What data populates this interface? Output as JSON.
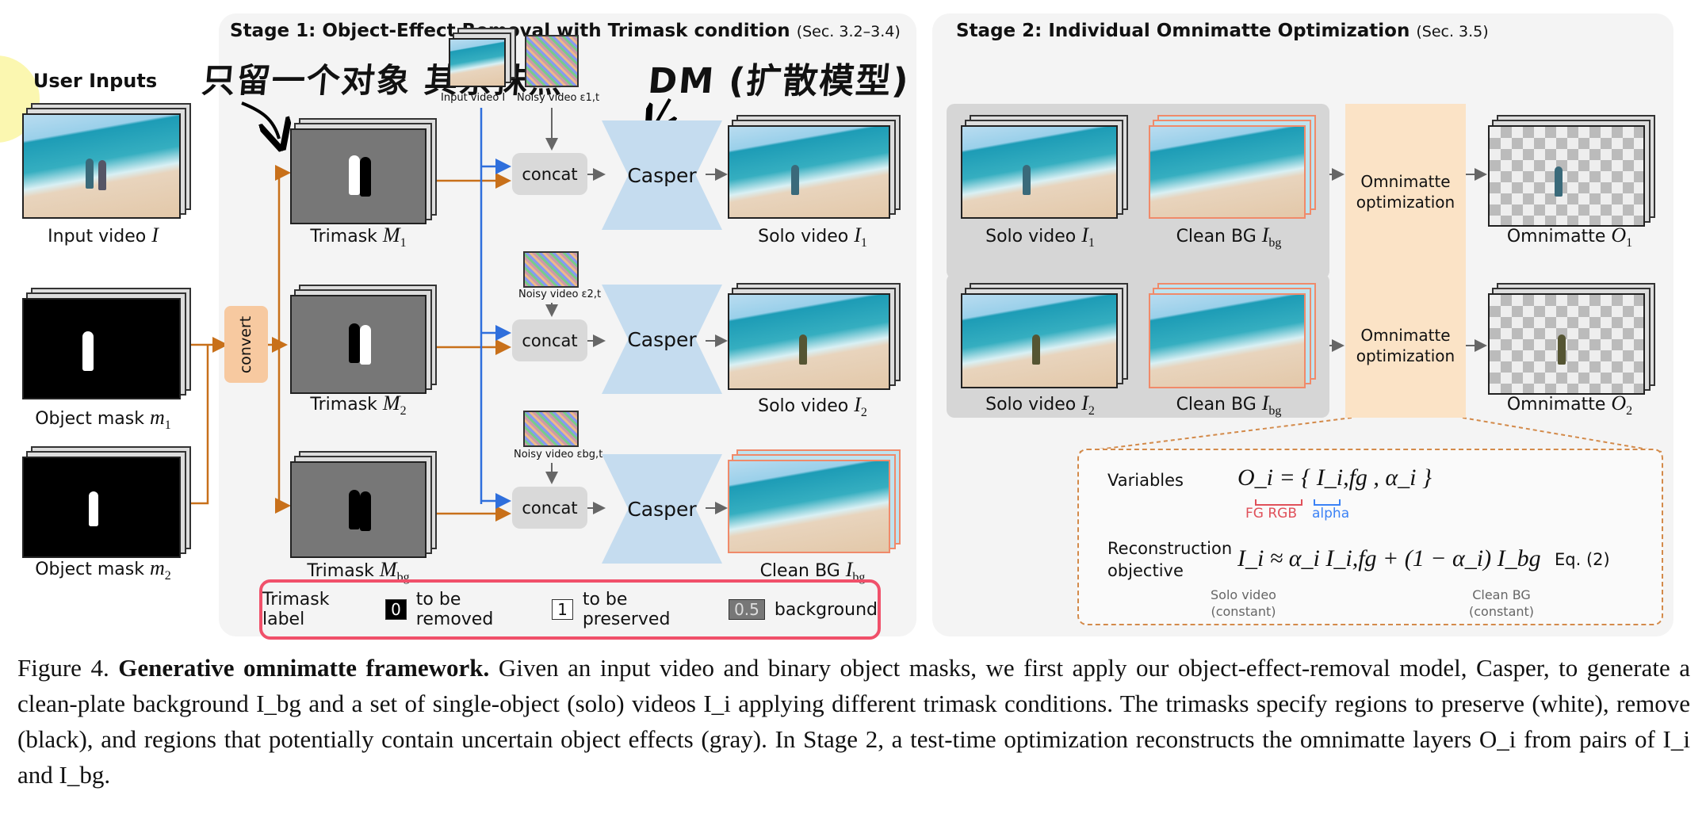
{
  "user_inputs": {
    "title": "User Inputs",
    "input_video": "Input video",
    "input_video_sym": "I",
    "mask1": "Object mask",
    "mask1_sym": "m",
    "mask1_sub": "1",
    "mask2": "Object mask",
    "mask2_sym": "m",
    "mask2_sub": "2",
    "convert": "convert"
  },
  "stage1": {
    "title": "Stage 1: Object-Effect Removal with Trimask condition",
    "ref": "(Sec. 3.2–3.4)",
    "annotation_left": "只留一个对象 其余抹黑",
    "annotation_right": "DM (扩散模型)",
    "small_input_label": "Input video I",
    "noisy_labels": [
      "Noisy video ε1,t",
      "Noisy video ε2,t",
      "Noisy video εbg,t"
    ],
    "rows": [
      {
        "trimask": "Trimask",
        "trimask_sub": "1",
        "concat": "concat",
        "model": "Casper",
        "output": "Solo video",
        "output_sub": "1"
      },
      {
        "trimask": "Trimask",
        "trimask_sub": "2",
        "concat": "concat",
        "model": "Casper",
        "output": "Solo video",
        "output_sub": "2"
      },
      {
        "trimask": "Trimask",
        "trimask_sub": "bg",
        "concat": "concat",
        "model": "Casper",
        "output": "Clean BG",
        "output_sub": "bg"
      }
    ],
    "legend": {
      "title": "Trimask label",
      "items": [
        {
          "value": "0",
          "text": "to be removed"
        },
        {
          "value": "1",
          "text": "to be preserved"
        },
        {
          "value": "0.5",
          "text": "background"
        }
      ]
    }
  },
  "stage2": {
    "title": "Stage 2: Individual Omnimatte Optimization",
    "ref": "(Sec. 3.5)",
    "rows": [
      {
        "solo": "Solo video",
        "solo_sub": "1",
        "bg": "Clean BG",
        "bg_sub": "bg",
        "opt": "Omnimatte optimization",
        "out": "Omnimatte",
        "out_sub": "1"
      },
      {
        "solo": "Solo video",
        "solo_sub": "2",
        "bg": "Clean BG",
        "bg_sub": "bg",
        "opt": "Omnimatte optimization",
        "out": "Omnimatte",
        "out_sub": "2"
      }
    ],
    "eq": {
      "variables_label": "Variables",
      "variables_eq": "O_i = { I_i,fg , α_i }",
      "fg_rgb": "FG RGB",
      "alpha": "alpha",
      "objective_label_1": "Reconstruction",
      "objective_label_2": "objective",
      "objective_eq": "I_i ≈ α_i I_i,fg + (1 − α_i) I_bg",
      "eq_num": "Eq. (2)",
      "solo_note_1": "Solo video",
      "solo_note_2": "(constant)",
      "bg_note_1": "Clean BG",
      "bg_note_2": "(constant)"
    }
  },
  "caption": {
    "prefix": "Figure 4.",
    "bold": "Generative omnimatte framework.",
    "text": "Given an input video and binary object masks, we first apply our object-effect-removal model, Casper, to generate a clean-plate background I_bg and a set of single-object (solo) videos I_i applying different trimask conditions. The trimasks specify regions to preserve (white), remove (black), and regions that potentially contain uncertain object effects (gray). In Stage 2, a test-time optimization reconstructs the omnimatte layers O_i from pairs of I_i and I_bg."
  },
  "colors": {
    "accent_orange": "#c8701a",
    "accent_blue": "#2f6fdc",
    "fg_red": "#e0505a",
    "alpha_blue": "#3b82f6",
    "highlight_red": "#f0506a"
  }
}
